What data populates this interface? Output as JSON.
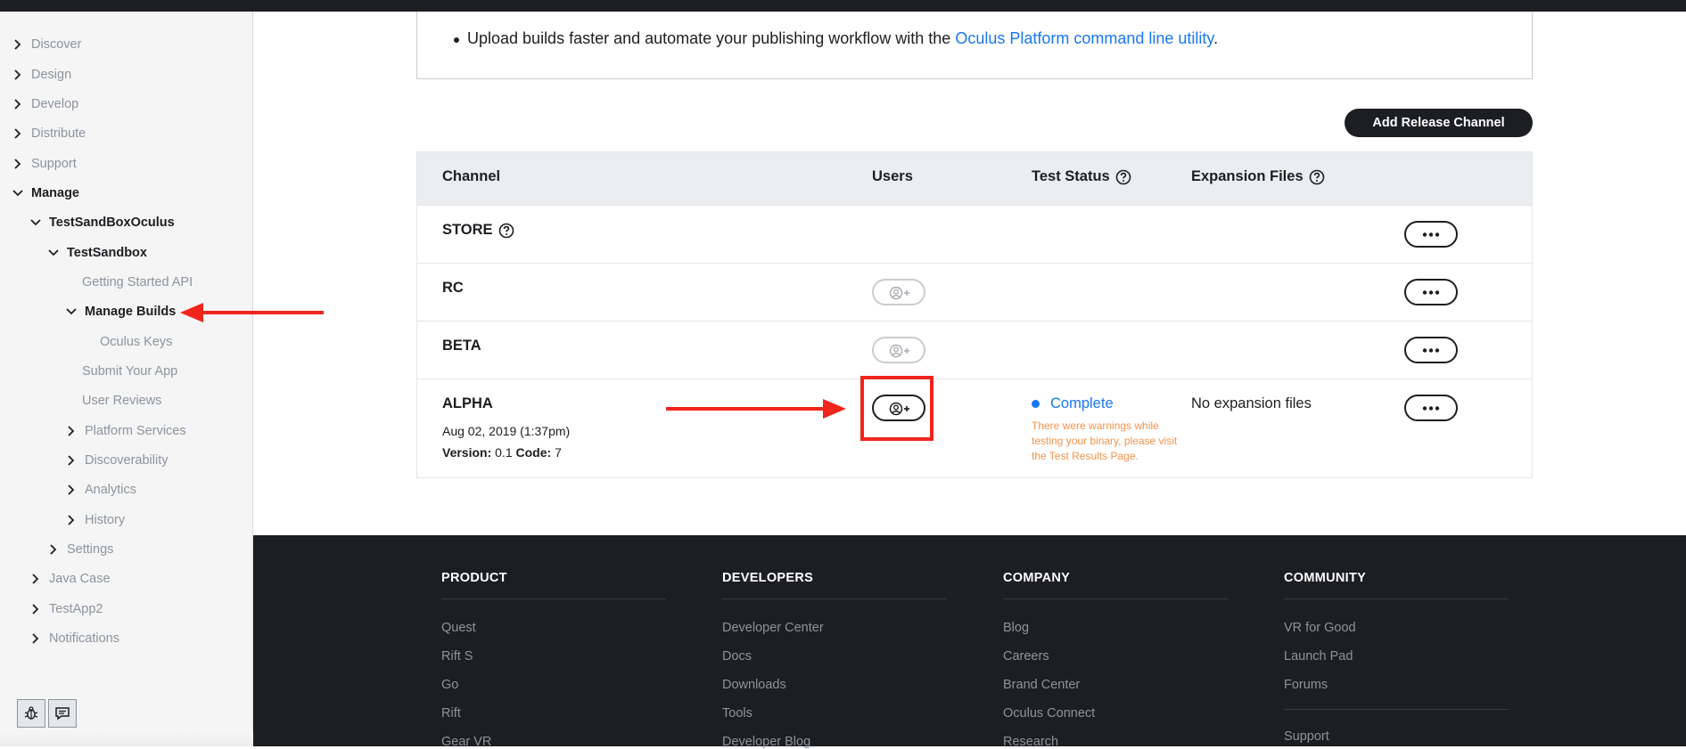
{
  "sidebar": {
    "items": [
      {
        "label": "Discover",
        "chevron": "right"
      },
      {
        "label": "Design",
        "chevron": "right"
      },
      {
        "label": "Develop",
        "chevron": "right"
      },
      {
        "label": "Distribute",
        "chevron": "right"
      },
      {
        "label": "Support",
        "chevron": "right"
      },
      {
        "label": "Manage",
        "chevron": "down"
      },
      {
        "label": "TestSandBoxOculus",
        "chevron": "down"
      },
      {
        "label": "TestSandbox",
        "chevron": "down"
      },
      {
        "label": "Getting Started API",
        "chevron": "none"
      },
      {
        "label": "Manage Builds",
        "chevron": "down"
      },
      {
        "label": "Oculus Keys",
        "chevron": "none"
      },
      {
        "label": "Submit Your App",
        "chevron": "none"
      },
      {
        "label": "User Reviews",
        "chevron": "none"
      },
      {
        "label": "Platform Services",
        "chevron": "right"
      },
      {
        "label": "Discoverability",
        "chevron": "right"
      },
      {
        "label": "Analytics",
        "chevron": "right"
      },
      {
        "label": "History",
        "chevron": "right"
      },
      {
        "label": "Settings",
        "chevron": "right"
      },
      {
        "label": "Java Case",
        "chevron": "right"
      },
      {
        "label": "TestApp2",
        "chevron": "right"
      },
      {
        "label": "Notifications",
        "chevron": "right"
      }
    ],
    "tools": [
      "bug-report-icon",
      "feedback-icon"
    ]
  },
  "info": {
    "text": "Upload builds faster and automate your publishing workflow with the",
    "link": "Oculus Platform command line utility",
    "suffix": "."
  },
  "toolbar": {
    "add_channel": "Add Release Channel"
  },
  "table": {
    "headers": {
      "channel": "Channel",
      "users": "Users",
      "test_status": "Test Status",
      "expansion": "Expansion Files"
    },
    "rows": [
      {
        "name": "STORE"
      },
      {
        "name": "RC"
      },
      {
        "name": "BETA"
      },
      {
        "name": "ALPHA",
        "date": "Aug 02, 2019 (1:37pm)",
        "version_label": "Version:",
        "version": "0.1",
        "code_label": "Code:",
        "code": "7",
        "status": "Complete",
        "warning": "There were warnings while testing your binary, please visit the Test Results Page.",
        "expansion": "No expansion files"
      }
    ]
  },
  "footer": {
    "columns": [
      {
        "title": "PRODUCT",
        "links": [
          "Quest",
          "Rift S",
          "Go",
          "Rift",
          "Gear VR"
        ]
      },
      {
        "title": "DEVELOPERS",
        "links": [
          "Developer Center",
          "Docs",
          "Downloads",
          "Tools",
          "Developer Blog"
        ]
      },
      {
        "title": "COMPANY",
        "links": [
          "Blog",
          "Careers",
          "Brand Center",
          "Oculus Connect",
          "Research"
        ]
      },
      {
        "title": "COMMUNITY",
        "links": [
          "VR for Good",
          "Launch Pad",
          "Forums",
          "Support"
        ]
      }
    ]
  },
  "colors": {
    "accent": "#1877f2",
    "warning": "#f4934b",
    "annotation": "#f0251c",
    "dark": "#1c1e21"
  }
}
